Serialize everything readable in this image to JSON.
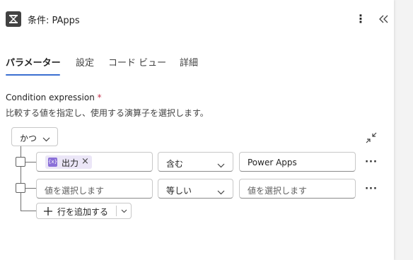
{
  "header": {
    "title": "条件: PApps",
    "icon": "condition-icon",
    "more_icon": "more-vertical-icon",
    "collapse_icon": "double-chevron-left-icon"
  },
  "tabs": [
    {
      "label": "パラメーター",
      "active": true
    },
    {
      "label": "設定",
      "active": false
    },
    {
      "label": "コード ビュー",
      "active": false
    },
    {
      "label": "詳細",
      "active": false
    }
  ],
  "condition": {
    "label": "Condition expression",
    "required_mark": "*",
    "description": "比較する値を指定し、使用する演算子を選択します。",
    "group_operator": "かつ",
    "rows": [
      {
        "left_token": "出力",
        "left_placeholder": "",
        "operator": "含む",
        "right_value": "Power Apps",
        "right_placeholder": ""
      },
      {
        "left_token": "",
        "left_placeholder": "値を選択します",
        "operator": "等しい",
        "right_value": "",
        "right_placeholder": "値を選択します"
      }
    ],
    "add_row_label": "行を追加する"
  },
  "colors": {
    "accent": "#3b6fd1",
    "token_bg": "#ebe6f7",
    "token_icon": "#8a6fd8",
    "required": "#c4314b"
  }
}
